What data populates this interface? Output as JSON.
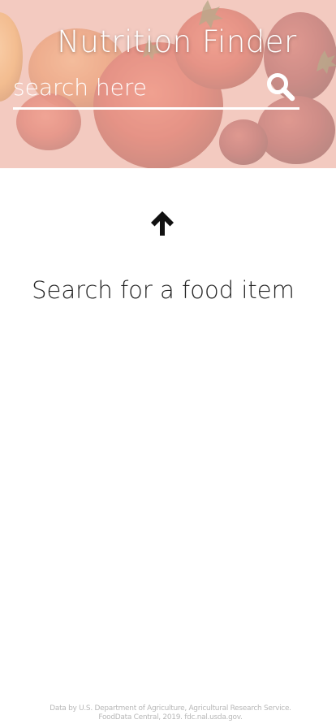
{
  "header": {
    "title": "Nutrition Finder",
    "background_image": "tomatoes-photo"
  },
  "search": {
    "placeholder": "search here",
    "value": "",
    "icon": "search-icon"
  },
  "main": {
    "arrow_icon": "arrow-up-icon",
    "prompt": "Search for a food item"
  },
  "footer": {
    "line1": "Data by U.S. Department of Agriculture, Agricultural Research Service.",
    "line2": "FoodData Central, 2019. fdc.nal.usda.gov."
  },
  "colors": {
    "hero_tint": "#e9b6a8",
    "text_dark": "#222222",
    "footer_text": "#b8b8b8"
  }
}
